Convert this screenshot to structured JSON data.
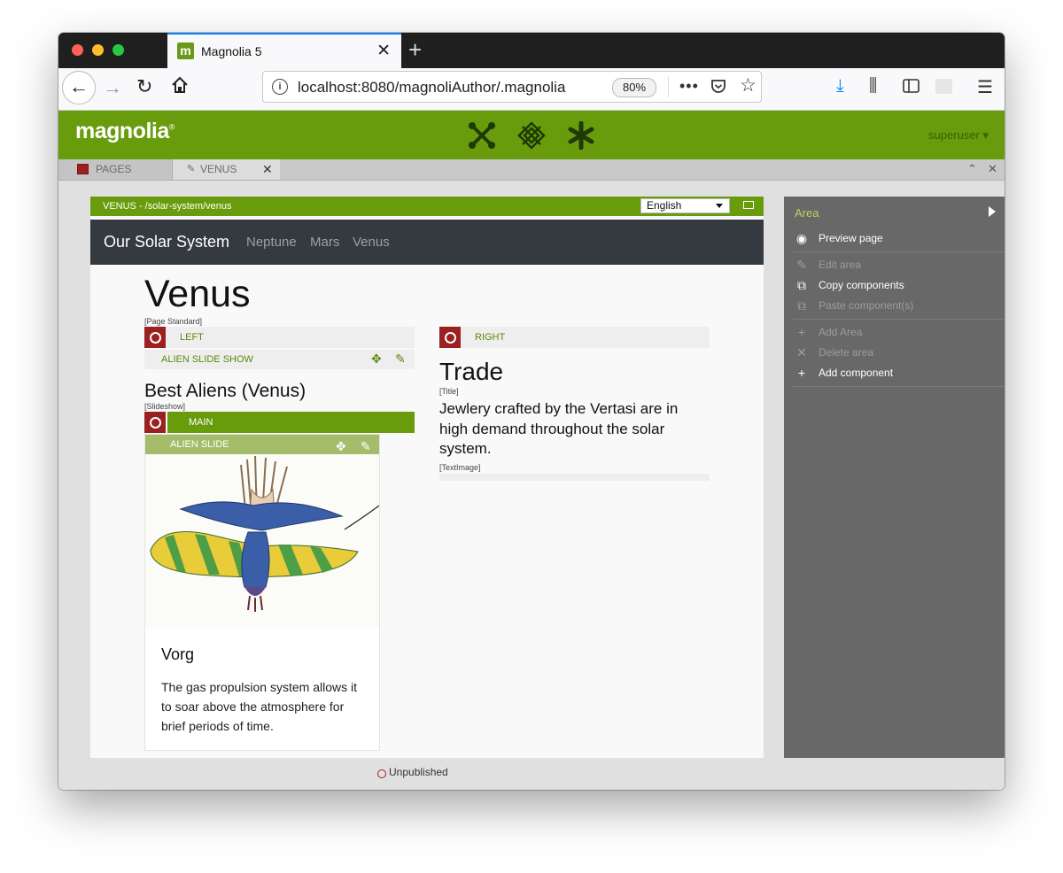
{
  "browser": {
    "tab_title": "Magnolia 5",
    "url": "localhost:8080/magnoliAuthor/.magnolia",
    "zoom": "80%"
  },
  "magnolia": {
    "logo": "magnolia",
    "user": "superuser ▾",
    "app_tabs": [
      {
        "label": "PAGES"
      },
      {
        "label": "VENUS"
      }
    ]
  },
  "page_editor": {
    "path_bar": "VENUS - /solar-system/venus",
    "language": "English",
    "site": {
      "brand": "Our Solar System",
      "nav": [
        "Neptune",
        "Mars",
        "Venus"
      ]
    },
    "title": "Venus",
    "title_tag": "[Page Standard]",
    "left_area": {
      "label": "LEFT",
      "component_label": "ALIEN SLIDE SHOW",
      "heading": "Best Aliens (Venus)",
      "heading_tag": "[Slideshow]",
      "main_area_label": "MAIN",
      "slide_label": "ALIEN SLIDE",
      "slide_title": "Vorg",
      "slide_text": "The gas propulsion system allows it to soar above the atmosphere for brief periods of time."
    },
    "right_area": {
      "label": "RIGHT",
      "heading": "Trade",
      "heading_tag": "[Title]",
      "text": "Jewlery crafted by the Vertasi are in high demand throughout the solar system.",
      "text_tag": "[TextImage]"
    }
  },
  "action_panel": {
    "header": "Area",
    "items": [
      {
        "label": "Preview page",
        "enabled": true,
        "icon": "eye-icon"
      },
      {
        "label": "Edit area",
        "enabled": false,
        "icon": "pencil-icon"
      },
      {
        "label": "Copy components",
        "enabled": true,
        "icon": "copy-icon"
      },
      {
        "label": "Paste component(s)",
        "enabled": false,
        "icon": "paste-icon"
      },
      {
        "label": "Add Area",
        "enabled": false,
        "icon": "plus-icon"
      },
      {
        "label": "Delete area",
        "enabled": false,
        "icon": "x-icon"
      },
      {
        "label": "Add component",
        "enabled": true,
        "icon": "plus-icon"
      }
    ]
  },
  "status": {
    "text": "Unpublished"
  },
  "colors": {
    "accent": "#689c0c",
    "area_icon": "#9b2020",
    "panel": "#686868"
  }
}
